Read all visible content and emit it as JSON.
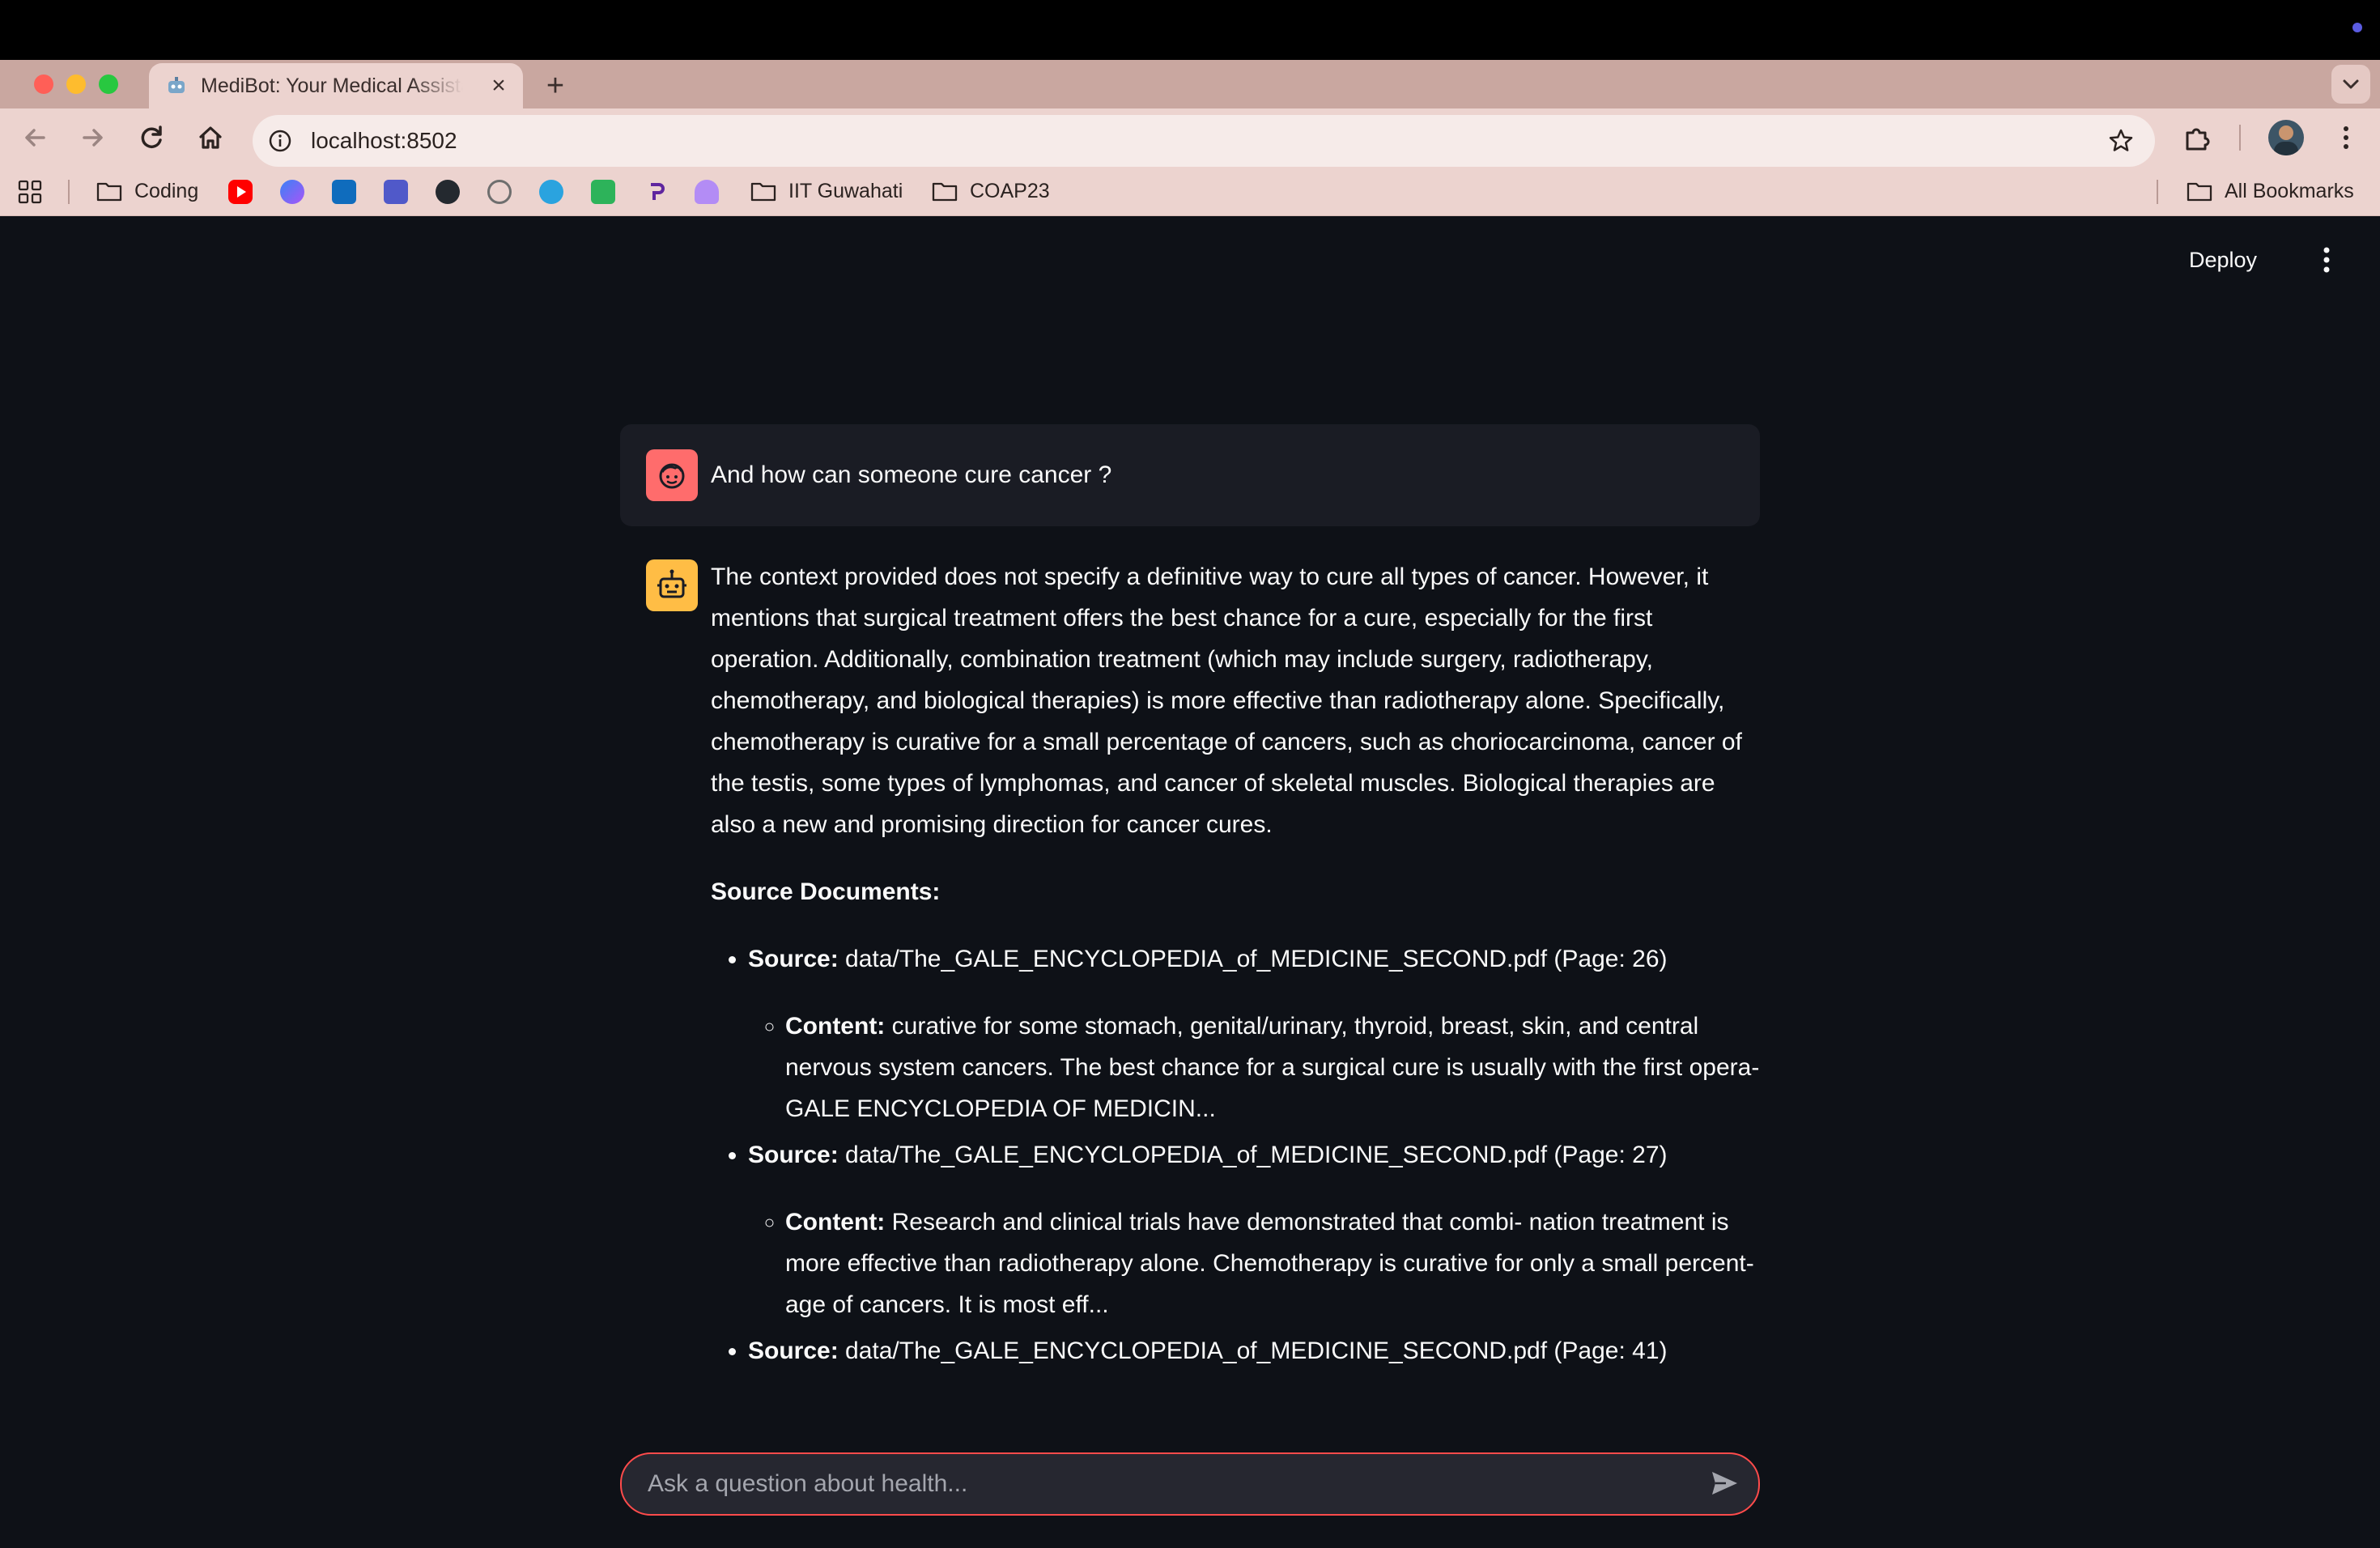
{
  "browser": {
    "tab_title": "MediBot: Your Medical Assistant",
    "url": "localhost:8502",
    "bookmarks": {
      "coding": "Coding",
      "iit": "IIT Guwahati",
      "coap": "COAP23",
      "all": "All Bookmarks"
    }
  },
  "app": {
    "deploy_label": "Deploy",
    "user_message": "And how can someone cure cancer ?",
    "answer": "The context provided does not specify a definitive way to cure all types of cancer. However, it mentions that surgical treatment offers the best chance for a cure, especially for the first operation. Additionally, combination treatment (which may include surgery, radiotherapy, chemotherapy, and biological therapies) is more effective than radiotherapy alone. Specifically, chemotherapy is curative for a small percentage of cancers, such as choriocarcinoma, cancer of the testis, some types of lymphomas, and cancer of skeletal muscles. Biological therapies are also a new and promising direction for cancer cures.",
    "sources_heading": "Source Documents:",
    "source_label": "Source:",
    "content_label": "Content:",
    "sources": [
      {
        "path": "data/The_GALE_ENCYCLOPEDIA_of_MEDICINE_SECOND.pdf (Page: 26)",
        "content": "curative for some stomach, genital/urinary, thyroid, breast, skin, and central nervous system cancers. The best chance for a surgical cure is usually with the first opera- GALE ENCYCLOPEDIA OF MEDICIN..."
      },
      {
        "path": "data/The_GALE_ENCYCLOPEDIA_of_MEDICINE_SECOND.pdf (Page: 27)",
        "content": "Research and clinical trials have demonstrated that combi- nation treatment is more effective than radiotherapy alone. Chemotherapy is curative for only a small percent- age of cancers. It is most eff..."
      },
      {
        "path": "data/The_GALE_ENCYCLOPEDIA_of_MEDICINE_SECOND.pdf (Page: 41)"
      }
    ],
    "input_placeholder": "Ask a question about health..."
  },
  "colors": {
    "app_background": "#0e1117",
    "accent": "#ff4b4b",
    "user_avatar": "#ff6c6c",
    "assistant_avatar": "#ffbd45",
    "browser_chrome": "#ecd3cf"
  }
}
